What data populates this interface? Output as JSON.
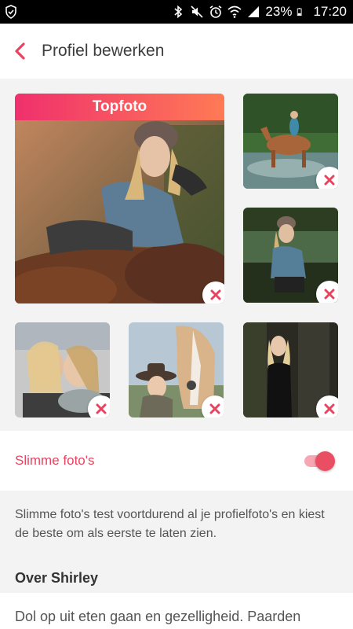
{
  "status_bar": {
    "battery_percent": "23%",
    "time": "17:20",
    "icons": [
      "shield-icon",
      "bluetooth-icon",
      "mute-icon",
      "alarm-icon",
      "wifi-icon",
      "signal-icon",
      "battery-icon"
    ]
  },
  "header": {
    "back_icon": "chevron-left-icon",
    "title": "Profiel bewerken"
  },
  "photos": {
    "top_label": "Topfoto",
    "delete_icon": "close-icon",
    "items": [
      {
        "slot": "main",
        "subject": "woman-sitting-in-autumn-leaves"
      },
      {
        "slot": "side-1",
        "subject": "rider-on-horse-in-water"
      },
      {
        "slot": "side-2",
        "subject": "woman-crouching-by-lake"
      },
      {
        "slot": "bottom-1",
        "subject": "two-women-selfie"
      },
      {
        "slot": "bottom-2",
        "subject": "woman-with-cowboy-hat-and-horse"
      },
      {
        "slot": "bottom-3",
        "subject": "woman-in-forest"
      }
    ]
  },
  "smart_photos": {
    "label": "Slimme foto's",
    "enabled": true,
    "description": "Slimme foto's test voortdurend al je profielfoto's en kiest de beste om als eerste te laten zien."
  },
  "about": {
    "title": "Over Shirley",
    "text": "Dol op uit eten gaan en gezelligheid. Paarden"
  },
  "colors": {
    "accent": "#e8435f",
    "badge_gradient_start": "#f0306d",
    "badge_gradient_end": "#ff7a55"
  }
}
